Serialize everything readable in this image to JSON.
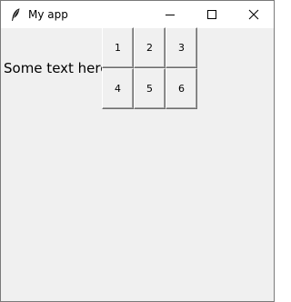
{
  "window": {
    "title": "My app",
    "icon": "feather-icon",
    "controls": [
      "minimize-icon",
      "maximize-icon",
      "close-icon"
    ]
  },
  "content": {
    "label": "Some text here",
    "grid": {
      "rows": 2,
      "cols": 3,
      "cells": [
        "1",
        "2",
        "3",
        "4",
        "5",
        "6"
      ]
    }
  },
  "colors": {
    "window_background": "#f0f0f0",
    "titlebar_background": "#ffffff",
    "border": "#7a7a7a"
  }
}
